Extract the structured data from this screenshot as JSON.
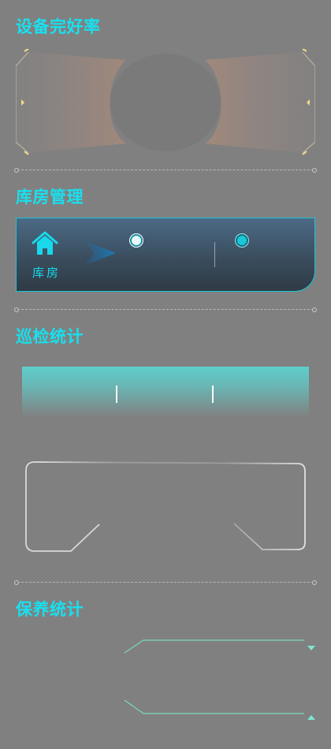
{
  "sections": {
    "equipment_rate": {
      "title": "设备完好率"
    },
    "warehouse": {
      "title": "库房管理",
      "label": "库房"
    },
    "inspection": {
      "title": "巡检统计"
    },
    "maintenance": {
      "title": "保养统计"
    }
  },
  "colors": {
    "accent": "#18e0ef",
    "background": "#808080",
    "card_border": "#17c6d6",
    "bar_top": "#5ecfcd"
  },
  "icons": {
    "warehouse": "home-icon",
    "arrow": "play-arrow-icon",
    "dropdown_down": "triangle-down-icon",
    "dropdown_up": "triangle-up-icon"
  }
}
